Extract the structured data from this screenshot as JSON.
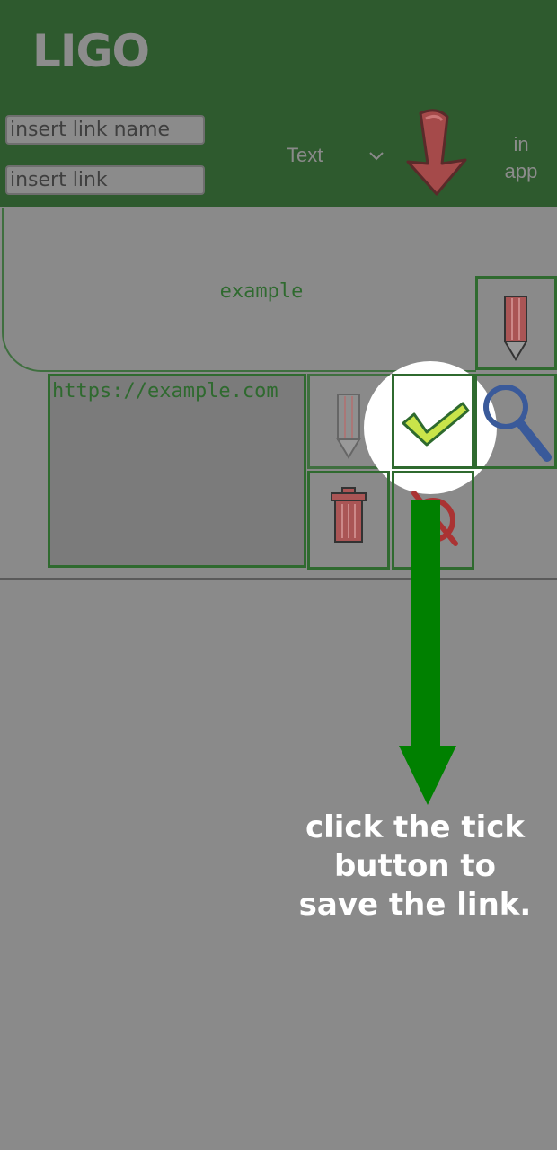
{
  "header": {
    "logo": "LIGO",
    "link_name_placeholder": "insert link name",
    "link_placeholder": "insert link",
    "type_select_value": "Text",
    "open_mode_label": "in app"
  },
  "link_card": {
    "title": "example",
    "url": "https://example.com"
  },
  "tutorial": {
    "message": "click the tick button to save the link."
  },
  "colors": {
    "header_bg": "#2e5a2e",
    "accent_green": "#008000",
    "overlay_gray": "#8a8a8a"
  }
}
